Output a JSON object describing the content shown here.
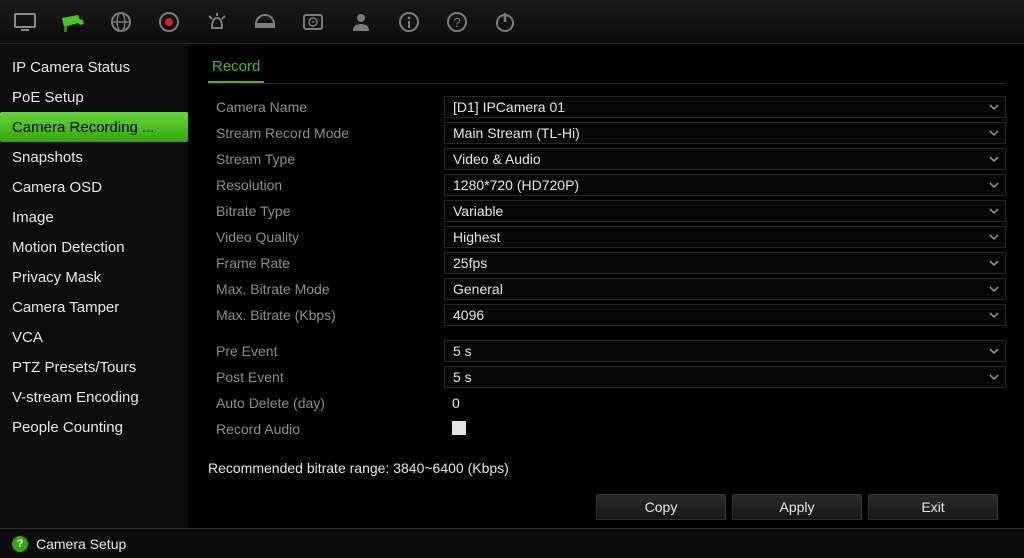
{
  "toolbar": {
    "icons": [
      "monitor",
      "camera",
      "disc",
      "record",
      "levels",
      "dome",
      "hdd",
      "user",
      "info",
      "help",
      "power"
    ],
    "active_index": 1
  },
  "sidebar": {
    "items": [
      {
        "label": "IP Camera Status"
      },
      {
        "label": "PoE Setup"
      },
      {
        "label": "Camera Recording ..."
      },
      {
        "label": "Snapshots"
      },
      {
        "label": "Camera OSD"
      },
      {
        "label": "Image"
      },
      {
        "label": "Motion Detection"
      },
      {
        "label": "Privacy Mask"
      },
      {
        "label": "Camera Tamper"
      },
      {
        "label": "VCA"
      },
      {
        "label": "PTZ Presets/Tours"
      },
      {
        "label": "V-stream Encoding"
      },
      {
        "label": "People Counting"
      }
    ],
    "active_index": 2
  },
  "tabs": {
    "record_label": "Record"
  },
  "form": {
    "camera_name": {
      "label": "Camera Name",
      "value": "[D1] IPCamera 01"
    },
    "stream_record_mode": {
      "label": "Stream Record Mode",
      "value": "Main Stream (TL-Hi)"
    },
    "stream_type": {
      "label": "Stream Type",
      "value": "Video & Audio"
    },
    "resolution": {
      "label": "Resolution",
      "value": "1280*720 (HD720P)"
    },
    "bitrate_type": {
      "label": "Bitrate Type",
      "value": "Variable"
    },
    "video_quality": {
      "label": "Video Quality",
      "value": "Highest"
    },
    "frame_rate": {
      "label": "Frame Rate",
      "value": "25fps"
    },
    "max_bitrate_mode": {
      "label": "Max. Bitrate Mode",
      "value": "General"
    },
    "max_bitrate_kbps": {
      "label": "Max. Bitrate (Kbps)",
      "value": "4096"
    },
    "pre_event": {
      "label": "Pre Event",
      "value": "5 s"
    },
    "post_event": {
      "label": "Post Event",
      "value": "5 s"
    },
    "auto_delete": {
      "label": "Auto Delete (day)",
      "value": "0"
    },
    "record_audio": {
      "label": "Record Audio",
      "checked": false
    }
  },
  "recommended": "Recommended bitrate range: 3840~6400 (Kbps)",
  "buttons": {
    "copy": "Copy",
    "apply": "Apply",
    "exit": "Exit"
  },
  "status_bar": {
    "label": "Camera Setup"
  }
}
